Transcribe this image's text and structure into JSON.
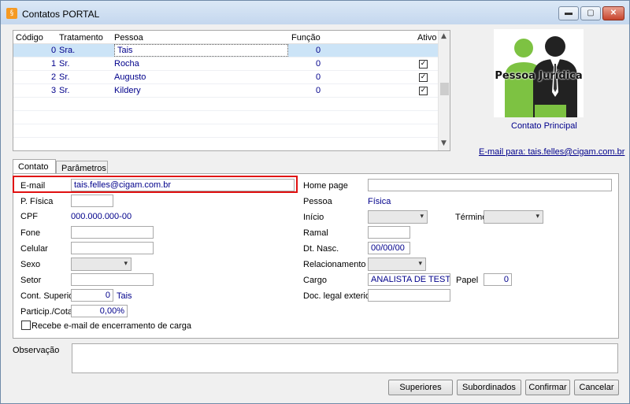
{
  "window": {
    "title": "Contatos PORTAL",
    "app_icon": "cigam-app-icon",
    "controls": {
      "minimize": "▬",
      "maximize": "▢",
      "close": "✕"
    }
  },
  "grid": {
    "columns": [
      "Código",
      "Tratamento",
      "Pessoa",
      "Função",
      "Ativo"
    ],
    "rows": [
      {
        "codigo": "0",
        "tratamento": "Sra.",
        "pessoa": "Tais",
        "funcao": "0",
        "ativo": false
      },
      {
        "codigo": "1",
        "tratamento": "Sr.",
        "pessoa": "Rocha",
        "funcao": "0",
        "ativo": true
      },
      {
        "codigo": "2",
        "tratamento": "Sr.",
        "pessoa": "Augusto",
        "funcao": "0",
        "ativo": true
      },
      {
        "codigo": "3",
        "tratamento": "Sr.",
        "pessoa": "Kildery",
        "funcao": "0",
        "ativo": true
      }
    ],
    "scroll_up": "▲",
    "scroll_down": "▼",
    "check_mark": "✓"
  },
  "logo": {
    "text": "Pessoa Jurídica"
  },
  "contact_principal_label": "Contato Principal",
  "email_link": "E-mail para: tais.felles@cigam.com.br",
  "tabs": [
    "Contato",
    "Parâmetros"
  ],
  "form": {
    "email_label": "E-mail",
    "email_value": "tais.felles@cigam.com.br",
    "pfisica_label": "P. Física",
    "cpf_label": "CPF",
    "cpf_value": "000.000.000-00",
    "fone_label": "Fone",
    "celular_label": "Celular",
    "sexo_label": "Sexo",
    "setor_label": "Setor",
    "cont_superior_label": "Cont. Superior",
    "cont_superior_value": "0",
    "cont_superior_name": "Tais",
    "particip_label": "Particip./Cotas",
    "particip_value": "0,00%",
    "recebe_label": "Recebe e-mail de encerramento de carga",
    "homepage_label": "Home page",
    "pessoa_label": "Pessoa",
    "pessoa_value": "Física",
    "inicio_label": "Início",
    "termino_label": "Término",
    "ramal_label": "Ramal",
    "dtnasc_label": "Dt. Nasc.",
    "dtnasc_value": "00/00/00",
    "relacionamento_label": "Relacionamento",
    "cargo_label": "Cargo",
    "cargo_value": "ANALISTA DE TESTES",
    "papel_label": "Papel",
    "papel_value": "0",
    "doc_label": "Doc. legal exterior",
    "caret": "▾"
  },
  "observacao_label": "Observação",
  "buttons": {
    "superiores": "Superiores",
    "subordinados": "Subordinados",
    "confirmar": "Confirmar",
    "cancelar": "Cancelar"
  },
  "colors": {
    "accent_text": "#00008b",
    "highlight_border": "#e01010",
    "selection": "#cce4f7"
  }
}
